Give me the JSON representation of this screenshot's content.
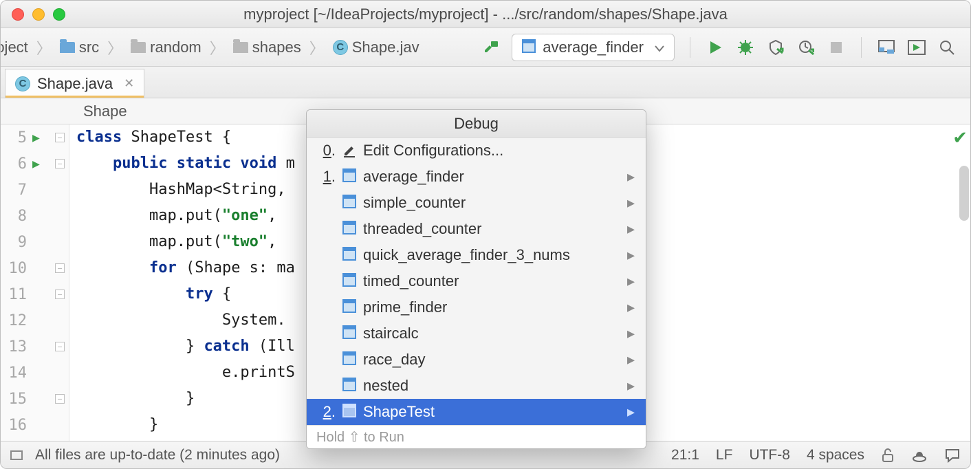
{
  "window": {
    "title": "myproject [~/IdeaProjects/myproject] - .../src/random/shapes/Shape.java"
  },
  "breadcrumb": {
    "project": "roject",
    "src": "src",
    "random": "random",
    "shapes": "shapes",
    "file": "Shape.jav"
  },
  "runConfig": {
    "selected": "average_finder"
  },
  "editor": {
    "tab": "Shape.java",
    "classLabel": "Shape",
    "lineStart": 5,
    "lines": [
      {
        "n": "5",
        "run": true,
        "fold": true,
        "html": "<span class='kw'>class</span> ShapeTest {"
      },
      {
        "n": "6",
        "run": true,
        "fold": true,
        "html": "    <span class='kw'>public static void</span> m"
      },
      {
        "n": "7",
        "run": false,
        "fold": false,
        "html": "        HashMap&lt;String,"
      },
      {
        "n": "8",
        "run": false,
        "fold": false,
        "html": "        map.put(<span class='str'>\"one\"</span>, "
      },
      {
        "n": "9",
        "run": false,
        "fold": false,
        "html": "        map.put(<span class='str'>\"two\"</span>, "
      },
      {
        "n": "10",
        "run": false,
        "fold": true,
        "html": "        <span class='kw'>for</span> (Shape s: ma"
      },
      {
        "n": "11",
        "run": false,
        "fold": true,
        "html": "            <span class='kw'>try</span> {"
      },
      {
        "n": "12",
        "run": false,
        "fold": false,
        "html": "                System."
      },
      {
        "n": "13",
        "run": false,
        "fold": true,
        "html": "            } <span class='kw'>catch</span> (Ill"
      },
      {
        "n": "14",
        "run": false,
        "fold": false,
        "html": "                e.printS"
      },
      {
        "n": "15",
        "run": false,
        "fold": true,
        "html": "            }"
      },
      {
        "n": "16",
        "run": false,
        "fold": false,
        "html": "        }"
      }
    ]
  },
  "popup": {
    "title": "Debug",
    "edit": {
      "prefix": "0",
      "label": "Edit Configurations..."
    },
    "items": [
      {
        "prefix": "1.",
        "label": "average_finder",
        "selected": false
      },
      {
        "prefix": "",
        "label": "simple_counter",
        "selected": false
      },
      {
        "prefix": "",
        "label": "threaded_counter",
        "selected": false
      },
      {
        "prefix": "",
        "label": "quick_average_finder_3_nums",
        "selected": false
      },
      {
        "prefix": "",
        "label": "timed_counter",
        "selected": false
      },
      {
        "prefix": "",
        "label": "prime_finder",
        "selected": false
      },
      {
        "prefix": "",
        "label": "staircalc",
        "selected": false
      },
      {
        "prefix": "",
        "label": "race_day",
        "selected": false
      },
      {
        "prefix": "",
        "label": "nested",
        "selected": false
      },
      {
        "prefix": "2.",
        "label": "ShapeTest",
        "selected": true
      }
    ],
    "footer": "Hold ⇧ to Run"
  },
  "status": {
    "message": "All files are up-to-date (2 minutes ago)",
    "caret": "21:1",
    "lineSep": "LF",
    "encoding": "UTF-8",
    "indent": "4 spaces"
  }
}
